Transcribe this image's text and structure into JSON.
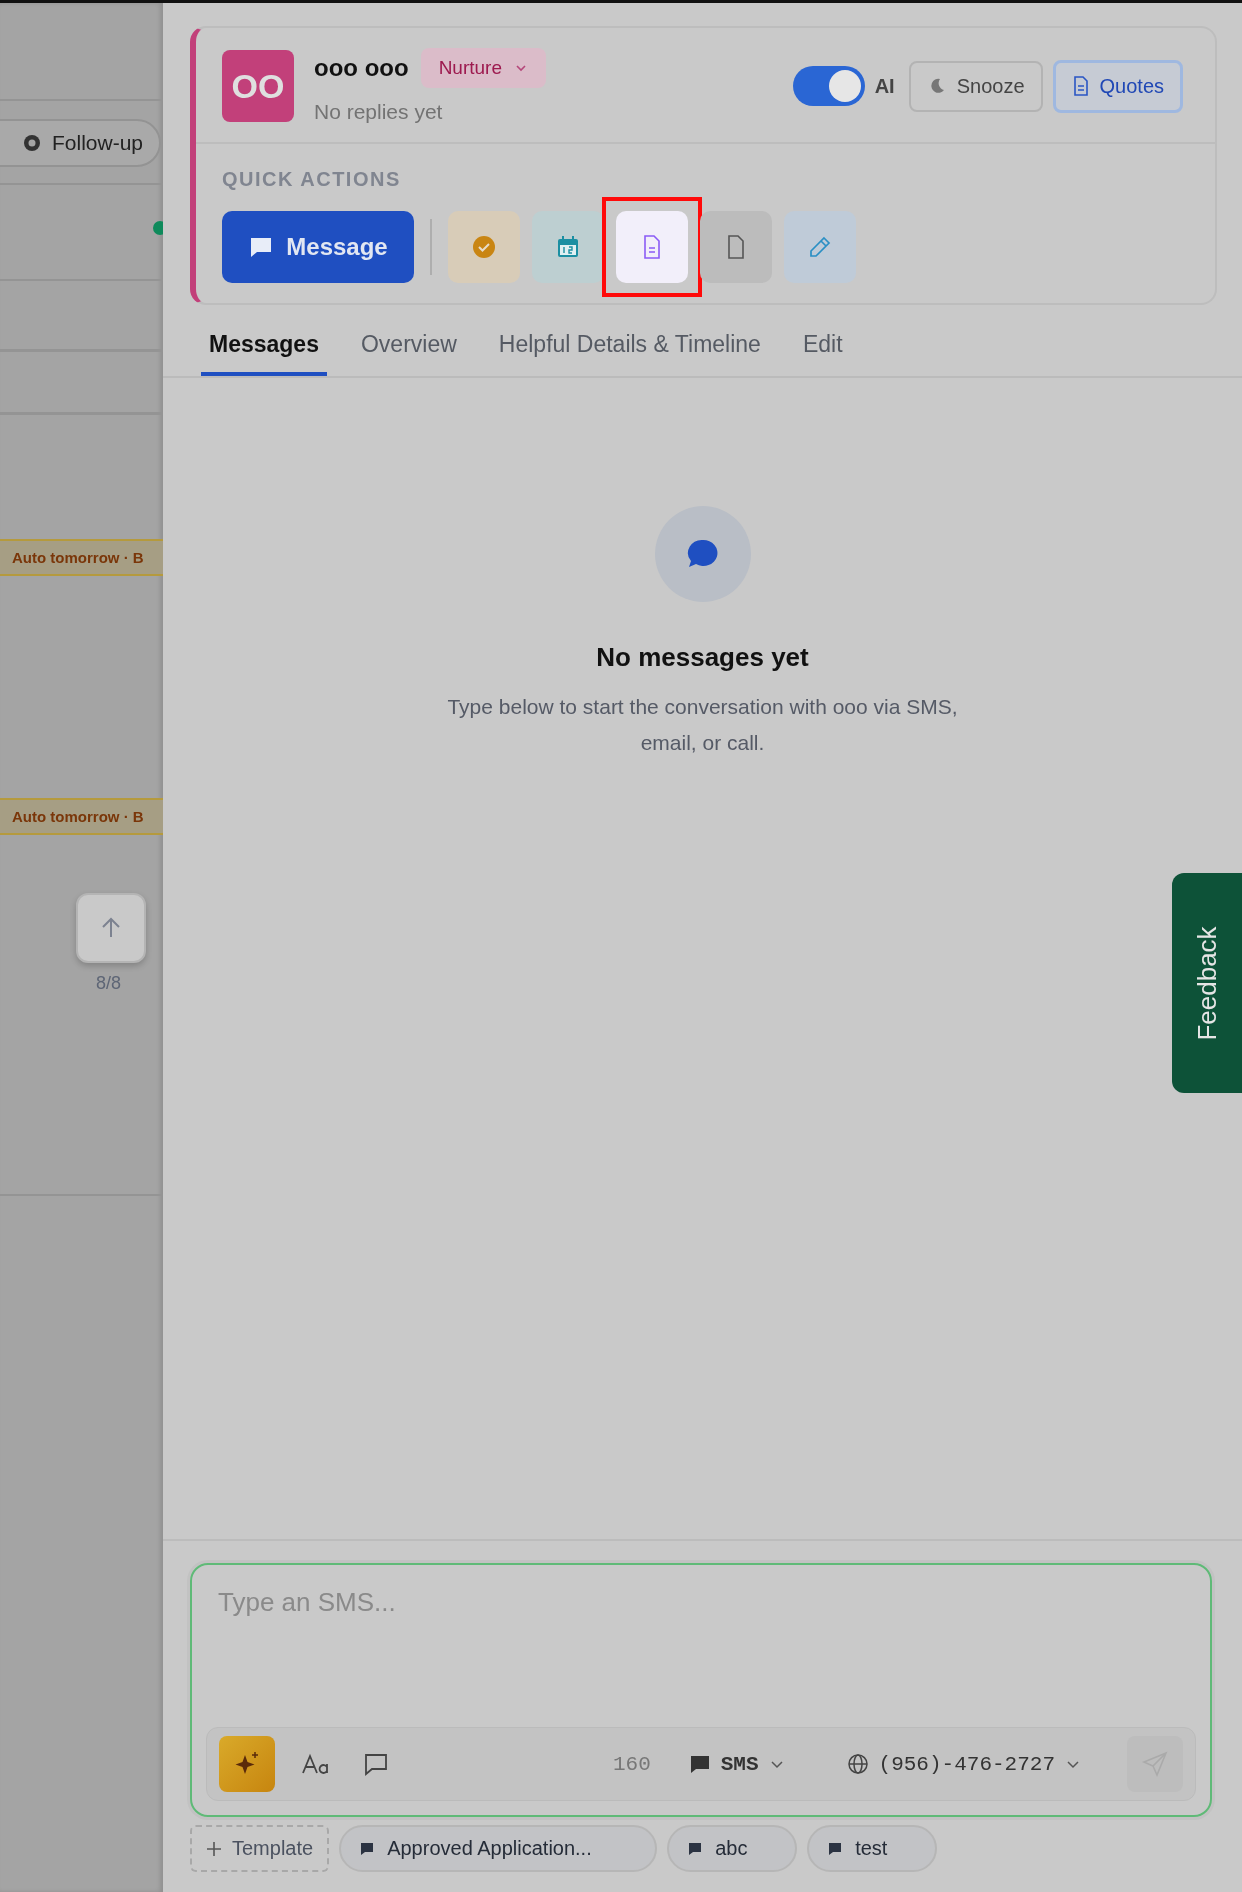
{
  "background_list": {
    "filter_pill": "Follow-up",
    "status_badges": [
      "Auto tomorrow · B",
      "Auto tomorrow · B"
    ],
    "scroll_counter": "8/8"
  },
  "contact": {
    "initials": "OO",
    "name": "ooo ooo",
    "stage": "Nurture",
    "subtitle": "No replies yet",
    "ai_toggle": {
      "label": "AI",
      "on": true
    },
    "buttons": [
      {
        "label": "Snooze",
        "kind": "snooze",
        "selected": false
      },
      {
        "label": "Quotes",
        "kind": "quotes",
        "selected": true
      }
    ]
  },
  "quick_actions": {
    "title": "QUICK ACTIONS",
    "primary": "Message",
    "actions": [
      {
        "kind": "task",
        "highlighted": false
      },
      {
        "kind": "calendar",
        "highlighted": false
      },
      {
        "kind": "document",
        "highlighted": true
      },
      {
        "kind": "file",
        "highlighted": false
      },
      {
        "kind": "edit",
        "highlighted": false
      }
    ]
  },
  "tabs": [
    {
      "label": "Messages",
      "selected": true
    },
    {
      "label": "Overview",
      "selected": false
    },
    {
      "label": "Helpful Details & Timeline",
      "selected": false
    },
    {
      "label": "Edit",
      "selected": false
    }
  ],
  "empty_state": {
    "title": "No messages yet",
    "text": "Type below to start the conversation with ooo via SMS, email, or call."
  },
  "composer": {
    "placeholder": "Type an SMS...",
    "char_count": "160",
    "channel": "SMS",
    "phone": "(956)-476-2727"
  },
  "templates": {
    "add_label": "Template",
    "items": [
      "Approved Application...",
      "abc",
      "test"
    ]
  },
  "feedback": "Feedback"
}
